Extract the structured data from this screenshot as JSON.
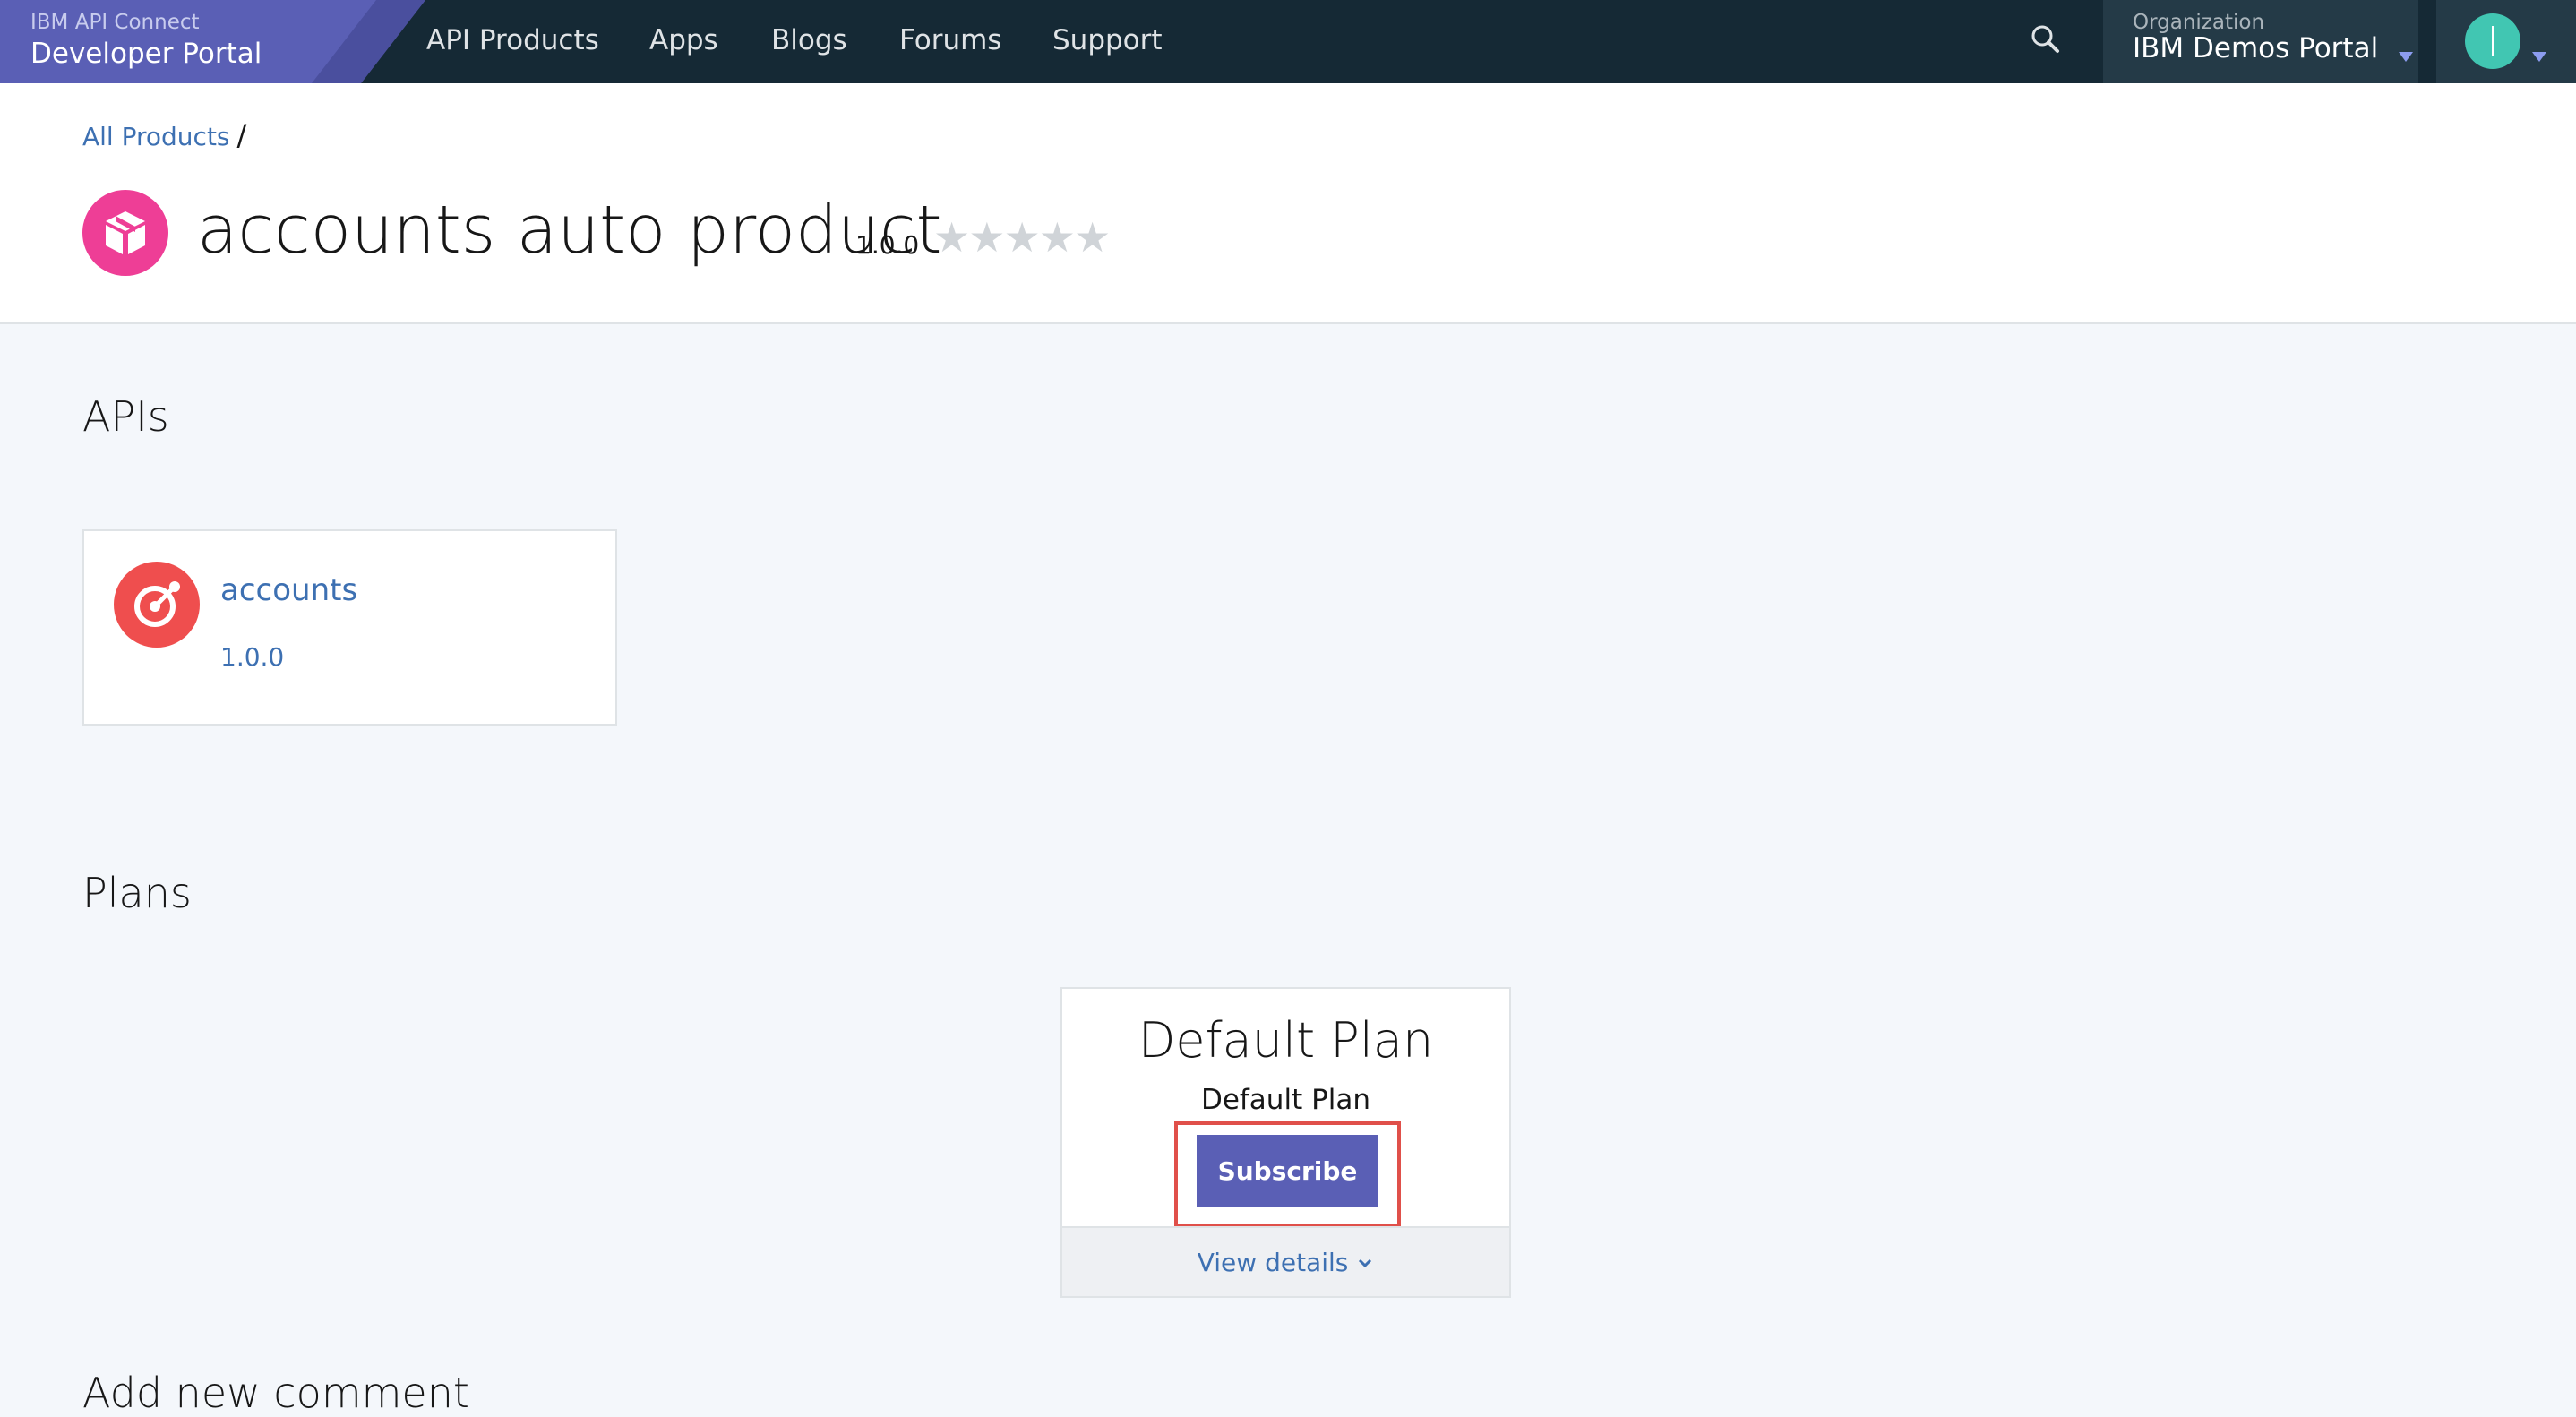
{
  "brand": {
    "product_line": "IBM API Connect",
    "portal_name": "Developer Portal"
  },
  "nav": {
    "items": [
      "API Products",
      "Apps",
      "Blogs",
      "Forums",
      "Support"
    ]
  },
  "org": {
    "label": "Organization",
    "name": "IBM Demos Portal"
  },
  "breadcrumb": {
    "link": "All Products",
    "separator": "/"
  },
  "product": {
    "title": "accounts auto product",
    "version": "1.0.0",
    "rating": 0,
    "rating_max": 5,
    "stars": "★★★★★"
  },
  "apis_section": {
    "title": "APIs",
    "items": [
      {
        "name": "accounts",
        "version": "1.0.0"
      }
    ]
  },
  "plans_section": {
    "title": "Plans",
    "plans": [
      {
        "title": "Default Plan",
        "description": "Default Plan",
        "subscribe_label": "Subscribe",
        "details_label": "View details"
      }
    ]
  },
  "comments_section": {
    "title": "Add new comment"
  },
  "colors": {
    "nav_bg": "#152935",
    "brand_bg": "#5a5fb5",
    "accent": "#3d70b2",
    "product_icon": "#ee3e96",
    "api_icon": "#ef4e4e",
    "highlight": "#e0504a"
  }
}
